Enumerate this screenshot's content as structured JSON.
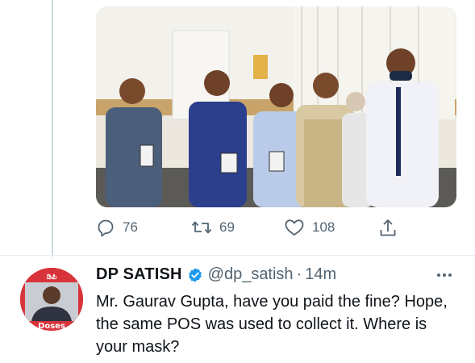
{
  "previous_tweet": {
    "actions": {
      "reply_count": "76",
      "retweet_count": "69",
      "like_count": "108"
    }
  },
  "reply_tweet": {
    "author_name": "DP SATISH",
    "handle": "@dp_satish",
    "separator": "·",
    "time": "14m",
    "text": "Mr. Gaurav Gupta, have you paid the fine? Hope, the same POS was used to collect it. Where is your mask?",
    "avatar_text_top": "ಡಿಪಿ",
    "avatar_text_bottom": "Doses"
  },
  "colors": {
    "icon_gray": "#536471",
    "verified_blue": "#1d9bf0",
    "thread_line": "#cfd9de"
  },
  "icons": [
    "reply-icon",
    "retweet-icon",
    "like-icon",
    "share-icon",
    "verified-badge-icon",
    "more-options-icon"
  ]
}
